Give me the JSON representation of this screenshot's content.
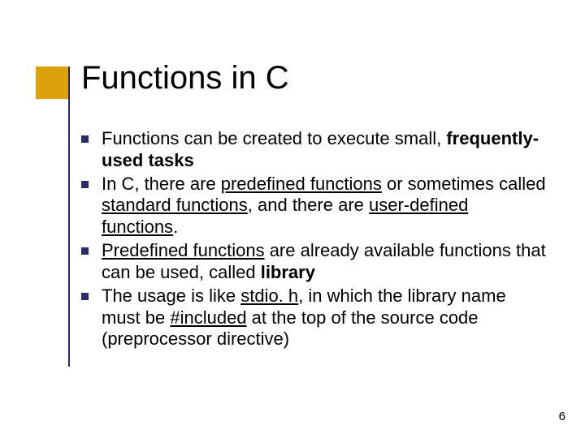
{
  "title": "Functions in C",
  "bullets": {
    "b0": {
      "pre": "Functions can be created to execute small, ",
      "bold": "frequently-used tasks"
    },
    "b1": {
      "t0": "In C, there are ",
      "u0": "predefined functions",
      "t1": " or sometimes called ",
      "u1": "standard functions",
      "t2": ", and there are ",
      "u2": "user-defined functions",
      "t3": "."
    },
    "b2": {
      "u0": "Predefined functions",
      "t0": " are already available functions that can be used, called ",
      "bold": "library"
    },
    "b3": {
      "t0": "The usage is like ",
      "u0": "stdio. h",
      "t1": ", in which the library name must be ",
      "u1": "#included",
      "t2": " at the top of the source code (preprocessor directive)"
    }
  },
  "page_number": "6"
}
